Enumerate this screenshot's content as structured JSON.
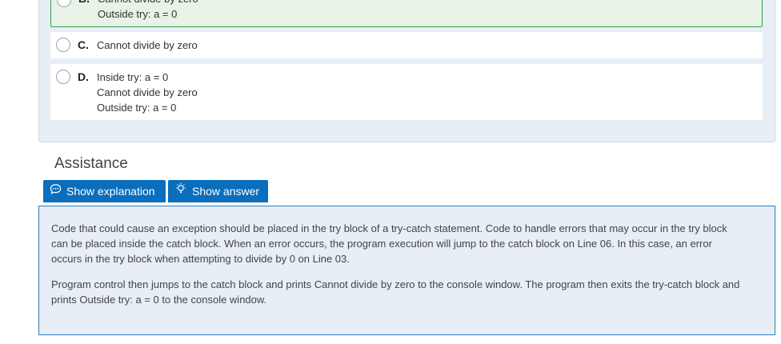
{
  "options": [
    {
      "letter": "B.",
      "lines": [
        "Cannot divide by zero",
        "Outside try: a = 0"
      ],
      "selected": true
    },
    {
      "letter": "C.",
      "lines": [
        "Cannot divide by zero"
      ],
      "selected": false
    },
    {
      "letter": "D.",
      "lines": [
        "Inside try: a = 0",
        "Cannot divide by zero",
        "Outside try: a = 0"
      ],
      "selected": false
    }
  ],
  "assistance": {
    "heading": "Assistance",
    "show_explanation_label": "Show explanation",
    "show_answer_label": "Show answer",
    "explanation_paragraphs": [
      "Code that could cause an exception should be placed in the try block of a try-catch statement. Code to handle errors that may occur in the try block can be placed inside the catch block. When an error occurs, the program execution will jump to the catch block on Line 06. In this case, an error occurs in the try block when attempting to divide by 0 on Line 03.",
      "Program control then jumps to the catch block and prints Cannot divide by zero to the console window. The program then exits the try-catch block and prints Outside try: a = 0 to the console window."
    ]
  },
  "icons": {
    "explanation": "speech-bubble-icon",
    "answer": "lightbulb-icon"
  },
  "colors": {
    "accent": "#0a6ebd",
    "selected_border": "#3f9b4d",
    "panel_bg": "#e7eef5"
  }
}
